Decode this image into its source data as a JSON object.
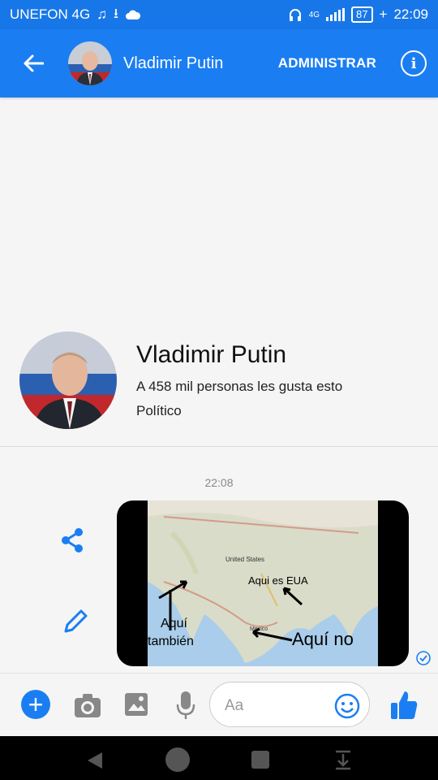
{
  "status_bar": {
    "carrier": "UNEFON 4G",
    "network": "4G",
    "battery": "87",
    "time": "22:09"
  },
  "header": {
    "title": "Vladimir Putin",
    "admin_label": "ADMINISTRAR"
  },
  "profile": {
    "name": "Vladimir Putin",
    "likes": "A 458 mil personas les gusta esto",
    "category": "Político"
  },
  "conversation": {
    "timestamp": "22:08",
    "image_message": {
      "map_labels": {
        "united_states": "United States",
        "mexico": "Mexico"
      },
      "annotations": {
        "aqui_es_eua": "Aqui es EUA",
        "aqui_tambien_1": "Aquí",
        "aqui_tambien_2": "también",
        "aqui_no": "Aquí no"
      }
    }
  },
  "composer": {
    "placeholder": "Aa"
  },
  "colors": {
    "accent": "#1a7ef2",
    "status_bar": "#1877e8"
  },
  "icons": [
    "back-arrow-icon",
    "info-icon",
    "share-icon",
    "edit-icon",
    "seen-check-icon",
    "plus-icon",
    "camera-icon",
    "gallery-icon",
    "mic-icon",
    "emoji-icon",
    "thumbs-up-icon"
  ]
}
